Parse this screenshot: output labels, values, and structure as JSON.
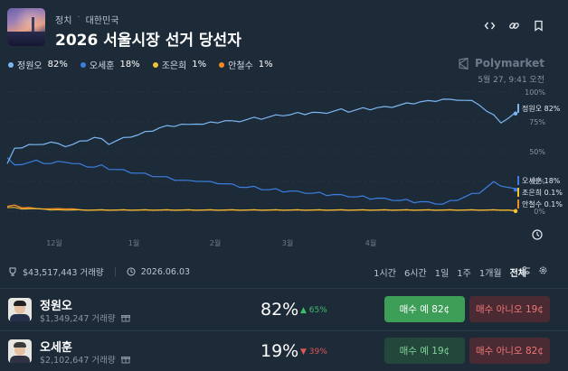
{
  "header": {
    "breadcrumb": [
      "정치",
      "대한민국"
    ],
    "breadcrumb_separator": "·",
    "title": "2026 서울시장 선거 당선자",
    "icons": [
      "code-icon",
      "link-icon",
      "bookmark-icon"
    ]
  },
  "legend": [
    {
      "name": "정원오",
      "pct": "82%",
      "color": "#7cb6f2"
    },
    {
      "name": "오세훈",
      "pct": "18%",
      "color": "#3b7ee0"
    },
    {
      "name": "조은희",
      "pct": "1%",
      "color": "#f1c232"
    },
    {
      "name": "안철수",
      "pct": "1%",
      "color": "#f08a24"
    }
  ],
  "brand": "Polymarket",
  "timestamp": "5월 27, 9:41 오전",
  "chart_data": {
    "type": "line",
    "x_ticks": [
      "12월",
      "1월",
      "2월",
      "3월",
      "4월"
    ],
    "y_ticks": [
      "100%",
      "75%",
      "50%",
      "25%",
      "0%"
    ],
    "ylim": [
      0,
      100
    ],
    "grid": true,
    "series": [
      {
        "name": "정원오",
        "end_label": "정원오 82%",
        "color": "#7cb6f2",
        "width": 1.2,
        "values": [
          40,
          52,
          54,
          56,
          55,
          57,
          58,
          56,
          55,
          56,
          58,
          60,
          62,
          60,
          57,
          59,
          61,
          63,
          64,
          66,
          68,
          70,
          71,
          72,
          73,
          72,
          74,
          73,
          74,
          75,
          76,
          75,
          76,
          77,
          78,
          78,
          79,
          80,
          81,
          81,
          82,
          82,
          83,
          82,
          83,
          84,
          85,
          84,
          85,
          86,
          86,
          87,
          87,
          88,
          89,
          90,
          91,
          92,
          92,
          93,
          94,
          93,
          94,
          93,
          92,
          90,
          84,
          80,
          75,
          78,
          82
        ]
      },
      {
        "name": "오세훈",
        "end_label": "오세훈 18%",
        "color": "#3b7ee0",
        "width": 1.2,
        "values": [
          45,
          38,
          40,
          41,
          42,
          41,
          40,
          41,
          42,
          40,
          39,
          38,
          37,
          38,
          36,
          35,
          34,
          33,
          32,
          31,
          30,
          29,
          28,
          27,
          26,
          25,
          26,
          25,
          24,
          24,
          23,
          22,
          21,
          20,
          20,
          19,
          18,
          18,
          17,
          17,
          16,
          16,
          15,
          15,
          14,
          14,
          13,
          13,
          12,
          12,
          11,
          11,
          10,
          10,
          9,
          9,
          8,
          8,
          7,
          7,
          6,
          8,
          10,
          12,
          14,
          16,
          20,
          24,
          22,
          20,
          18
        ]
      },
      {
        "name": "조은희",
        "end_label": "조은희 0.1%",
        "color": "#f1c232",
        "width": 1,
        "values": [
          3,
          3,
          2,
          2,
          2,
          2,
          1,
          1,
          1,
          1,
          1,
          1,
          1,
          1,
          1,
          1,
          1,
          1,
          1,
          1,
          1,
          1,
          1,
          1,
          1,
          1,
          1,
          1,
          1,
          1,
          1,
          1,
          1,
          1,
          1,
          1,
          1,
          1,
          1,
          1,
          1,
          1,
          1,
          1,
          1,
          1,
          1,
          1,
          1,
          1,
          1,
          1,
          1,
          1,
          1,
          1,
          1,
          1,
          1,
          1,
          1,
          1,
          1,
          1,
          1,
          1,
          1,
          1,
          1,
          1,
          0.1
        ]
      },
      {
        "name": "안철수",
        "end_label": "안철수 0.1%",
        "color": "#f08a24",
        "width": 1.4,
        "values": [
          4,
          5,
          3,
          3,
          2,
          2,
          2,
          2,
          2,
          2,
          1,
          1,
          1,
          1,
          1,
          1,
          1,
          1,
          1,
          1,
          1,
          1,
          1,
          1,
          1,
          1,
          1,
          1,
          1,
          1,
          1,
          1,
          1,
          1,
          1,
          1,
          1,
          1,
          1,
          1,
          1,
          1,
          1,
          1,
          1,
          1,
          1,
          1,
          1,
          1,
          1,
          1,
          1,
          1,
          1,
          1,
          1,
          1,
          1,
          1,
          1,
          1,
          1,
          1,
          1,
          1,
          1,
          1,
          1,
          1,
          0.1
        ]
      }
    ]
  },
  "stats": {
    "volume": "$43,517,443 거래량",
    "end_date": "2026.06.03"
  },
  "ranges": [
    "1시간",
    "6시간",
    "1일",
    "1주",
    "1개월",
    "전체"
  ],
  "active_range": "전체",
  "candidates": [
    {
      "name": "정원오",
      "volume": "$1,349,247 거래량",
      "pct": "82%",
      "delta": "▲ 65%",
      "delta_color": "#3fbf6a",
      "yes_label": "매수 예 82¢",
      "no_label": "매수 아니오 19¢",
      "yes_strong": true
    },
    {
      "name": "오세훈",
      "volume": "$2,102,647 거래량",
      "pct": "19%",
      "delta": "▼ 39%",
      "delta_color": "#e05555",
      "yes_label": "매수 예 19¢",
      "no_label": "매수 아니오 82¢",
      "yes_strong": false
    }
  ]
}
